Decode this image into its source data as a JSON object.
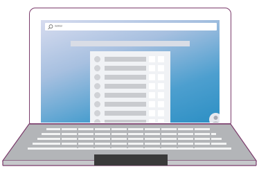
{
  "browser": {
    "url_text": "www"
  },
  "app_list": {
    "rows": 8
  },
  "colors": {
    "lid_outline": "#7a3a6a",
    "keyboard_deck": "#b3b5b8",
    "touchpad": "#3a3a3a"
  },
  "icons": {
    "search": "search-icon",
    "avatar": "user-avatar-icon"
  }
}
